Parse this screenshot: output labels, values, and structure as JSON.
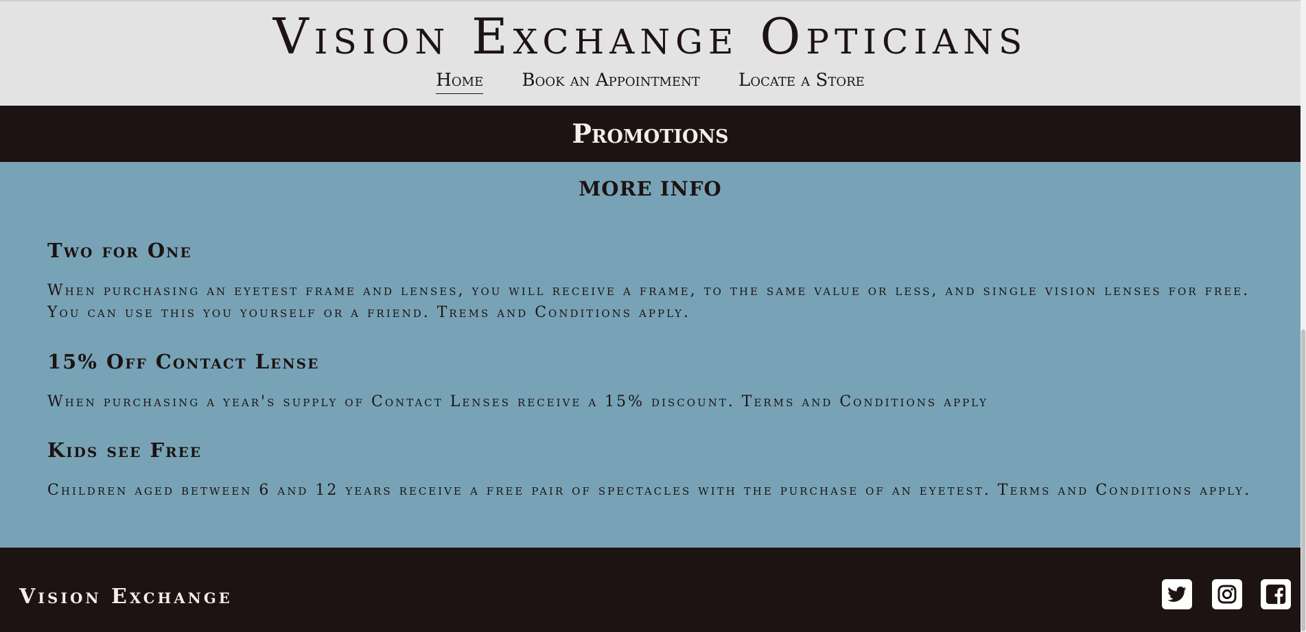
{
  "header": {
    "brand": "Vision Exchange Opticians",
    "nav": [
      {
        "label": "Home",
        "active": true
      },
      {
        "label": "Book an Appointment",
        "active": false
      },
      {
        "label": "Locate a Store",
        "active": false
      }
    ]
  },
  "promotions_bar": {
    "title": "Promotions"
  },
  "content": {
    "more_info": "MORE INFO",
    "promos": [
      {
        "title": "Two for One",
        "text": "When purchasing an eyetest frame and lenses, you will receive a frame, to the same value or less, and single vision lenses for free. You can use this you yourself or a friend. Trems and Conditions apply."
      },
      {
        "title": "15% Off Contact Lense",
        "text": "When purchasing a year's supply of Contact Lenses receive a 15% discount. Terms and Conditions apply"
      },
      {
        "title": "Kids see Free",
        "text": "Children aged between 6 and 12 years receive a free pair of spectacles with the purchase of an eyetest. Terms and Conditions apply."
      }
    ]
  },
  "footer": {
    "brand": "Vision Exchange",
    "social": [
      {
        "icon": "twitter-icon"
      },
      {
        "icon": "instagram-icon"
      },
      {
        "icon": "facebook-icon"
      }
    ]
  },
  "colors": {
    "header_bg": "#e3e3e3",
    "dark_bg": "#1d1312",
    "content_bg": "#78a3b6",
    "text_dark": "#1c1312",
    "text_light": "#f3eee7"
  }
}
